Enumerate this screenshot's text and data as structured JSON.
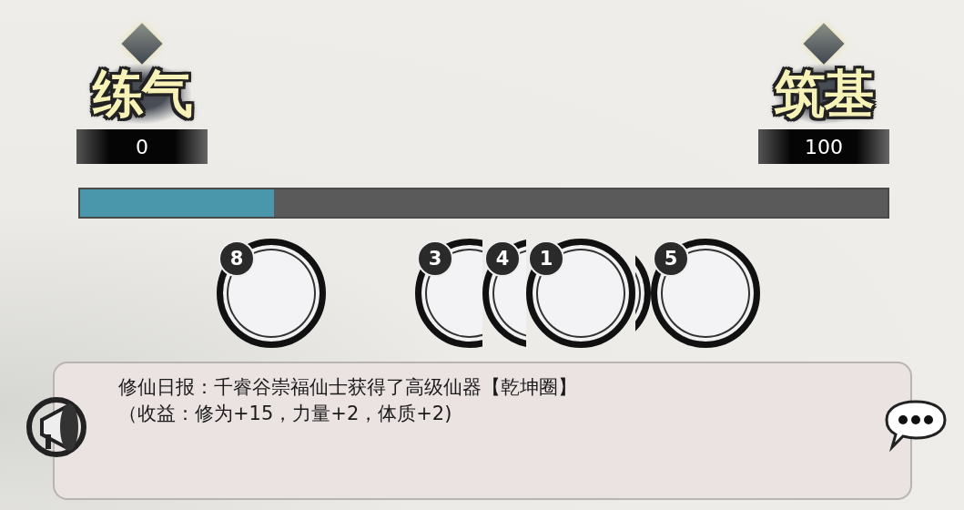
{
  "realms": [
    {
      "name": "练气",
      "value": "0"
    },
    {
      "name": "筑基",
      "value": "100"
    }
  ],
  "progress": {
    "level": 0.24
  },
  "avatar_groups": [
    [
      {
        "kind": "numbered",
        "badge": "8"
      }
    ],
    [
      {
        "kind": "numbered",
        "badge": "3"
      },
      {
        "kind": "numbered",
        "badge": "4"
      },
      {
        "kind": "numbered",
        "badge": "1"
      },
      {
        "kind": "covered"
      },
      {
        "kind": "numbered",
        "badge": "5"
      }
    ]
  ],
  "news": {
    "lines": [
      "修仙日报：千睿谷崇福仙士获得了高级仙器【乾坤圈】",
      "（收益：修为+15，力量+2，体质+2)"
    ]
  }
}
